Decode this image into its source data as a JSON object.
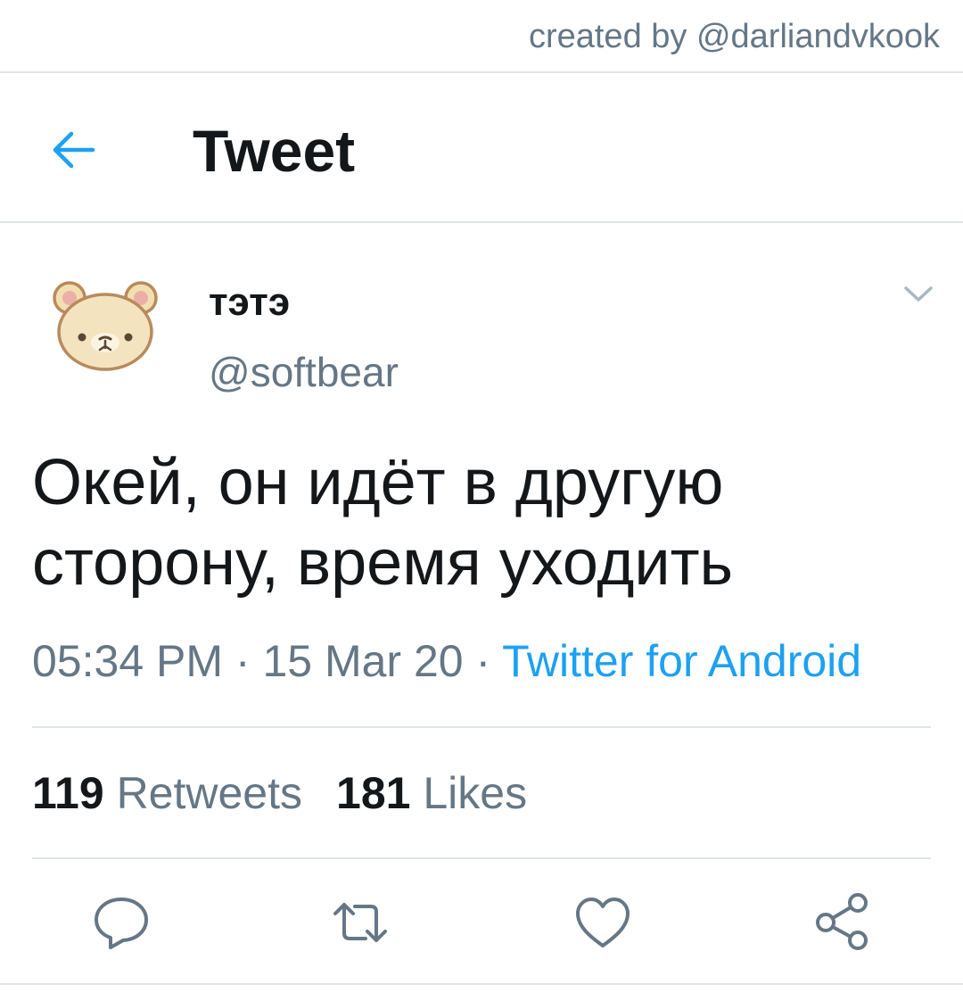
{
  "watermark": "created by @darliandvkook",
  "header": {
    "title": "Tweet",
    "back_icon": "arrow-left-icon"
  },
  "tweet": {
    "author": {
      "display_name": "тэтэ",
      "handle": "@softbear",
      "avatar_icon": "bear-face-avatar"
    },
    "text_line1": "Окей, он идёт в другую",
    "text_line2": "сторону, время уходить",
    "time": "05:34 PM",
    "sep1": " · ",
    "date": "15 Mar 20",
    "sep2": " · ",
    "source": "Twitter for Android",
    "retweets_count": "119",
    "retweets_label": "Retweets",
    "likes_count": "181",
    "likes_label": "Likes"
  },
  "actions": {
    "reply_icon": "reply-icon",
    "retweet_icon": "retweet-icon",
    "like_icon": "heart-icon",
    "share_icon": "share-icon"
  },
  "colors": {
    "accent": "#1da1f2",
    "secondary_text": "#657786",
    "primary_text": "#14171a",
    "divider": "#dfe4e8",
    "background": "#ffffff"
  }
}
